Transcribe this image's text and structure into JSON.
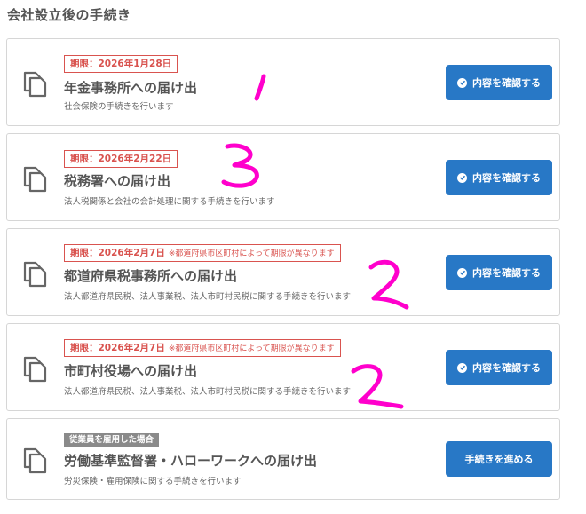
{
  "page_title": "会社設立後の手続き",
  "cards": [
    {
      "badge": "期限：2026年1月28日",
      "badge_note": "",
      "title": "年金事務所への届け出",
      "desc": "社会保険の手続きを行います",
      "button": "内容を確認する"
    },
    {
      "badge": "期限：2026年2月22日",
      "badge_note": "",
      "title": "税務署への届け出",
      "desc": "法人税関係と会社の会計処理に関する手続きを行います",
      "button": "内容を確認する"
    },
    {
      "badge": "期限：2026年2月7日",
      "badge_note": "※都道府県市区町村によって期限が異なります",
      "title": "都道府県税事務所への届け出",
      "desc": "法人都道府県民税、法人事業税、法人市町村民税に関する手続きを行います",
      "button": "内容を確認する"
    },
    {
      "badge": "期限：2026年2月7日",
      "badge_note": "※都道府県市区町村によって期限が異なります",
      "title": "市町村役場への届け出",
      "desc": "法人都道府県民税、法人事業税、法人市町村民税に関する手続きを行います",
      "button": "内容を確認する"
    },
    {
      "badge": "従業員を雇用した場合",
      "title": "労働基準監督署・ハローワークへの届け出",
      "desc": "労災保険・雇用保険に関する手続きを行います",
      "button": "手続きを進める"
    }
  ],
  "annotations": {
    "color": "#ff00cc",
    "marks": [
      "1",
      "3",
      "2",
      "2"
    ]
  },
  "colors": {
    "accent": "#2878c6",
    "deadline": "#d9534f",
    "condition_badge": "#8a8a8a"
  },
  "icons": {
    "card_icon": "documents-icon",
    "button_icon": "check-circle-icon"
  }
}
